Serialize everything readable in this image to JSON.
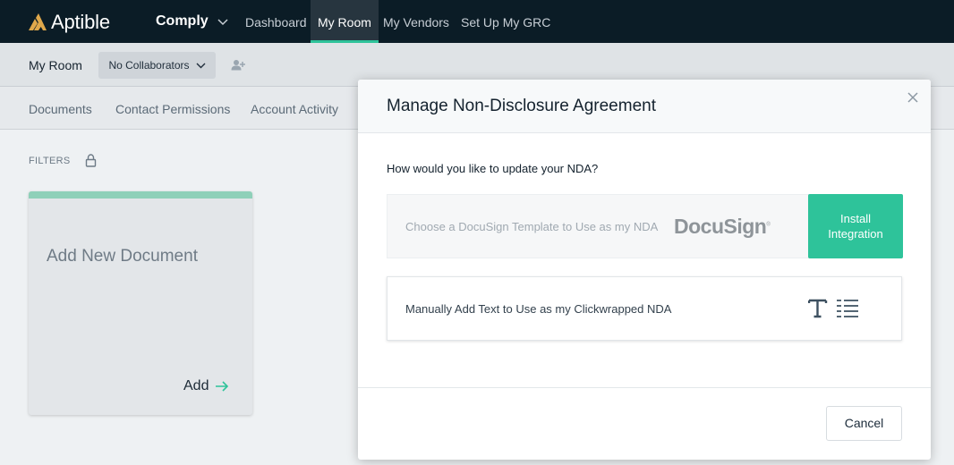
{
  "topnav": {
    "brand": "Aptible",
    "product": "Comply",
    "links": [
      "Dashboard",
      "My Room",
      "My Vendors",
      "Set Up My GRC"
    ],
    "active_link": "My Room",
    "background": "#0b1c26",
    "accent": "#2ec39a"
  },
  "subheader": {
    "title": "My Room",
    "collaborators": "No Collaborators"
  },
  "tabs": [
    "Documents",
    "Contact Permissions",
    "Account Activity"
  ],
  "filters": {
    "label": "FILTERS"
  },
  "card": {
    "title": "Add New Document",
    "add_label": "Add"
  },
  "modal": {
    "title": "Manage Non-Disclosure Agreement",
    "question": "How would you like to update your NDA?",
    "option_docusign": {
      "label": "Choose a DocuSign Template to Use as my NDA",
      "brand": "DocuSign",
      "button_line1": "Install",
      "button_line2": "Integration"
    },
    "option_manual": {
      "label": "Manually Add Text to Use as my Clickwrapped NDA",
      "icon": "text-format-icon"
    },
    "cancel_label": "Cancel"
  }
}
